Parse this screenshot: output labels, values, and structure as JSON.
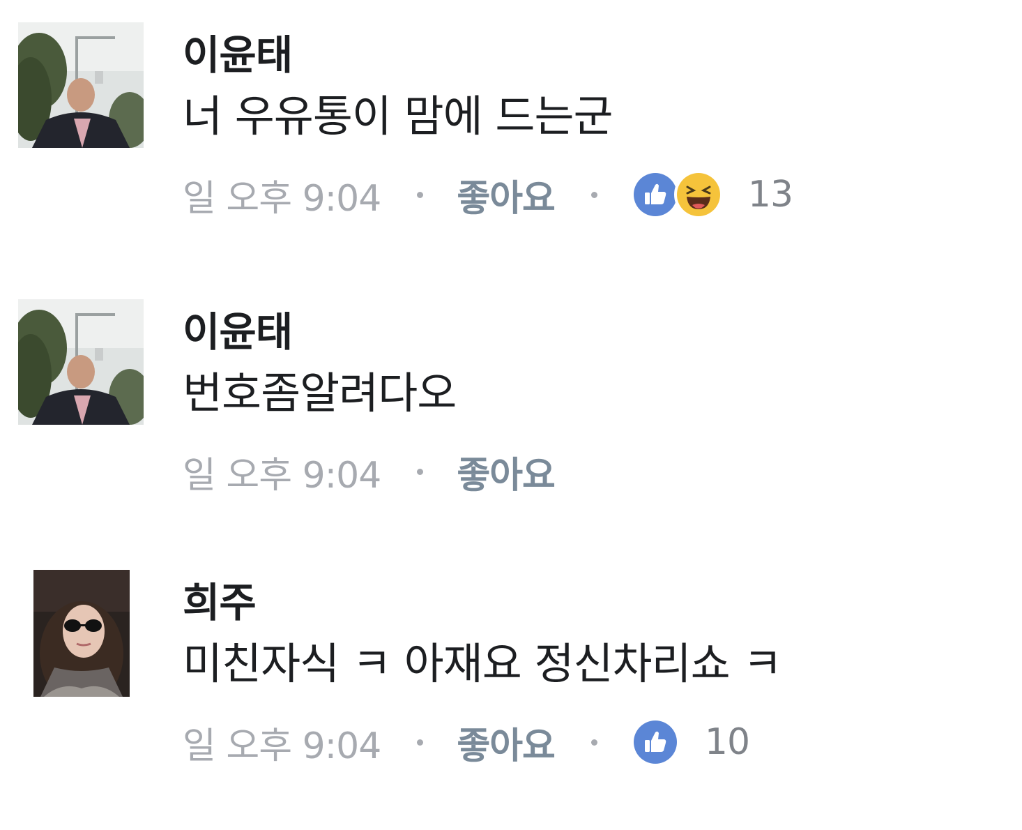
{
  "comments": [
    {
      "author": "이윤태",
      "text": "너 우유통이 맘에 드는군",
      "time": "일 오후 9:04",
      "like_label": "좋아요",
      "reactions": [
        "like-icon",
        "haha-icon"
      ],
      "reaction_count": "13"
    },
    {
      "author": "이윤태",
      "text": "번호좀알려다오",
      "time": "일 오후 9:04",
      "like_label": "좋아요"
    },
    {
      "author": "희주",
      "text": "미친자식 ㅋ 아재요 정신차리쇼 ㅋ",
      "time": "일 오후 9:04",
      "like_label": "좋아요",
      "reactions": [
        "like-icon"
      ],
      "reaction_count": "10"
    }
  ],
  "colors": {
    "like_blue": "#5b86d6",
    "haha_yellow": "#f5c33b",
    "meta_gray": "#a7aab0",
    "text": "#1c1e21"
  }
}
